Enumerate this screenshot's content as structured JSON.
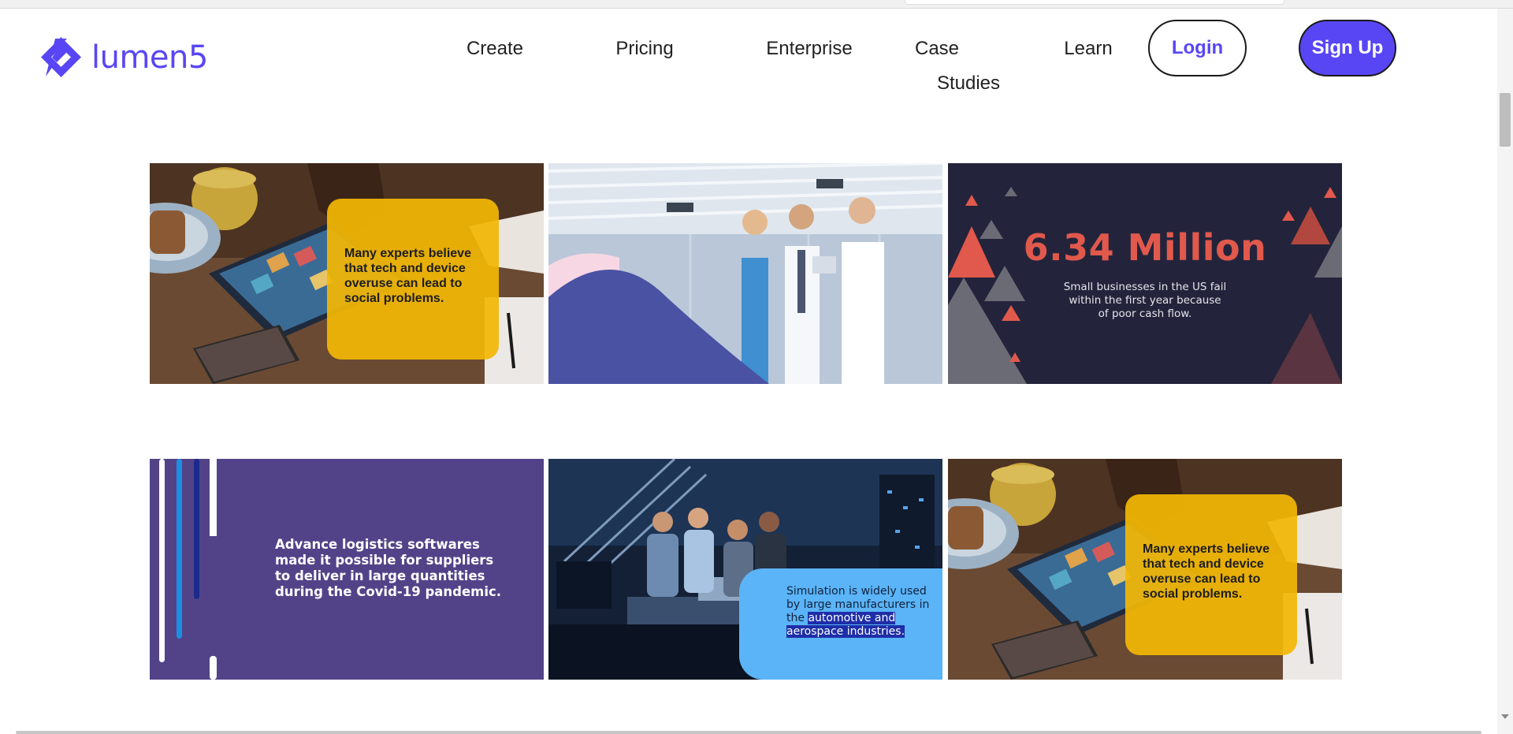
{
  "brand": {
    "name": "lumen5",
    "color": "#5846f5"
  },
  "nav": {
    "create": "Create",
    "pricing": "Pricing",
    "enterprise": "Enterprise",
    "case_studies_line1": "Case",
    "case_studies_line2": "Studies",
    "learn": "Learn"
  },
  "buttons": {
    "login": "Login",
    "signup": "Sign Up"
  },
  "cards": {
    "tech1": {
      "lines": [
        "Many experts believe",
        "that tech and device",
        "overuse can lead to",
        "social problems."
      ]
    },
    "stat": {
      "headline": "6.34 Million",
      "lines": [
        "Small businesses in the US fail",
        "within the first year because",
        "of poor cash flow."
      ]
    },
    "logistics": {
      "lines": [
        "Advance logistics softwares",
        "made it possible for suppliers",
        "to deliver in large quantities",
        "during the Covid-19 pandemic."
      ]
    },
    "simulation": {
      "lines": [
        "Simulation is widely used",
        "by large manufacturers in"
      ],
      "line3_plain": "the ",
      "line3_highlight": "automotive and",
      "line4_highlight": "aerospace industries."
    },
    "tech2": {
      "lines": [
        "Many experts believe",
        "that tech and device",
        "overuse can lead to",
        "social problems."
      ]
    }
  },
  "icons": [
    "lumen5-logo-icon",
    "scroll-down-arrow-icon"
  ],
  "colors": {
    "accent": "#5846f5",
    "yellow_box": "#f2b705",
    "navy": "#23243b",
    "coral": "#e0594c",
    "purple": "#524389",
    "light_blue": "#5ab4f7"
  }
}
